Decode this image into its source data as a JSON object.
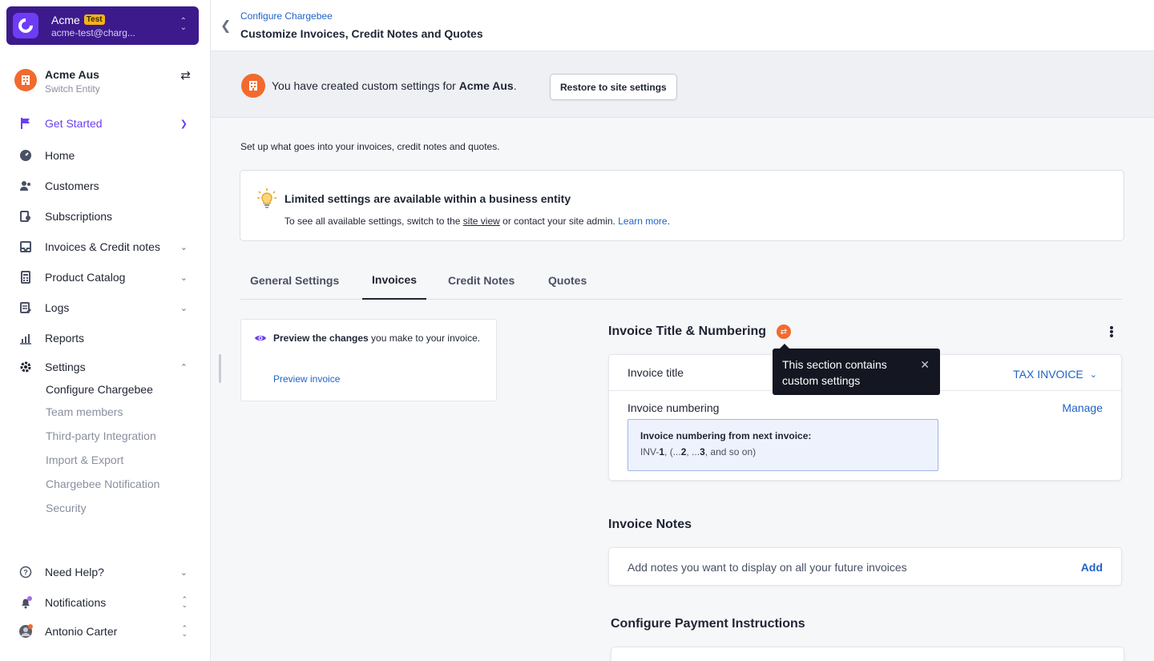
{
  "account": {
    "name": "Acme",
    "badge": "Test",
    "email": "acme-test@charg..."
  },
  "entity": {
    "name": "Acme Aus",
    "subtitle": "Switch Entity"
  },
  "nav": {
    "get_started": "Get Started",
    "home": "Home",
    "customers": "Customers",
    "subscriptions": "Subscriptions",
    "invoices": "Invoices & Credit notes",
    "catalog": "Product Catalog",
    "logs": "Logs",
    "reports": "Reports",
    "settings": "Settings",
    "settings_sub": [
      "Configure Chargebee",
      "Team members",
      "Third-party Integration",
      "Import & Export",
      "Chargebee Notification",
      "Security"
    ],
    "help": "Need Help?",
    "notifications": "Notifications",
    "user": "Antonio Carter"
  },
  "header": {
    "breadcrumb": "Configure Chargebee",
    "title": "Customize Invoices, Credit Notes and Quotes"
  },
  "custom_banner": {
    "prefix": "You have created custom settings for",
    "entity": "Acme Aus",
    "suffix": ".",
    "button": "Restore to site settings"
  },
  "intro": "Set up what goes into your invoices, credit notes and quotes.",
  "limited": {
    "title": "Limited settings are available within a business entity",
    "desc_1": "To see all available settings, switch to the ",
    "site_view": "site view",
    "desc_2": " or contact your site admin. ",
    "learn_more": "Learn more",
    "desc_3": "."
  },
  "tabs": [
    "General Settings",
    "Invoices",
    "Credit Notes",
    "Quotes"
  ],
  "active_tab": "Invoices",
  "preview": {
    "bold": "Preview the changes",
    "rest": " you make to your invoice.",
    "link": "Preview invoice"
  },
  "invoice_section": {
    "title": "Invoice Title & Numbering",
    "title_label": "Invoice title",
    "title_value": "TAX INVOICE",
    "numbering_label": "Invoice numbering",
    "manage": "Manage",
    "numbering_box_title": "Invoice numbering from next invoice:",
    "numbering_prefix": "INV-",
    "n1": "1",
    "sep1": ", (...",
    "n2": "2",
    "sep2": ", ...",
    "n3": "3",
    "sep3": ", and so on)"
  },
  "tooltip": "This section contains custom settings",
  "notes_section": {
    "title": "Invoice Notes",
    "placeholder": "Add notes you want to display on all your future invoices",
    "add": "Add"
  },
  "payment_section": {
    "title": "Configure Payment Instructions"
  },
  "colors": {
    "accent": "#6c3ef4",
    "link": "#1f63c8",
    "orange": "#f26a2e",
    "account_bg": "#3c1a8c"
  }
}
